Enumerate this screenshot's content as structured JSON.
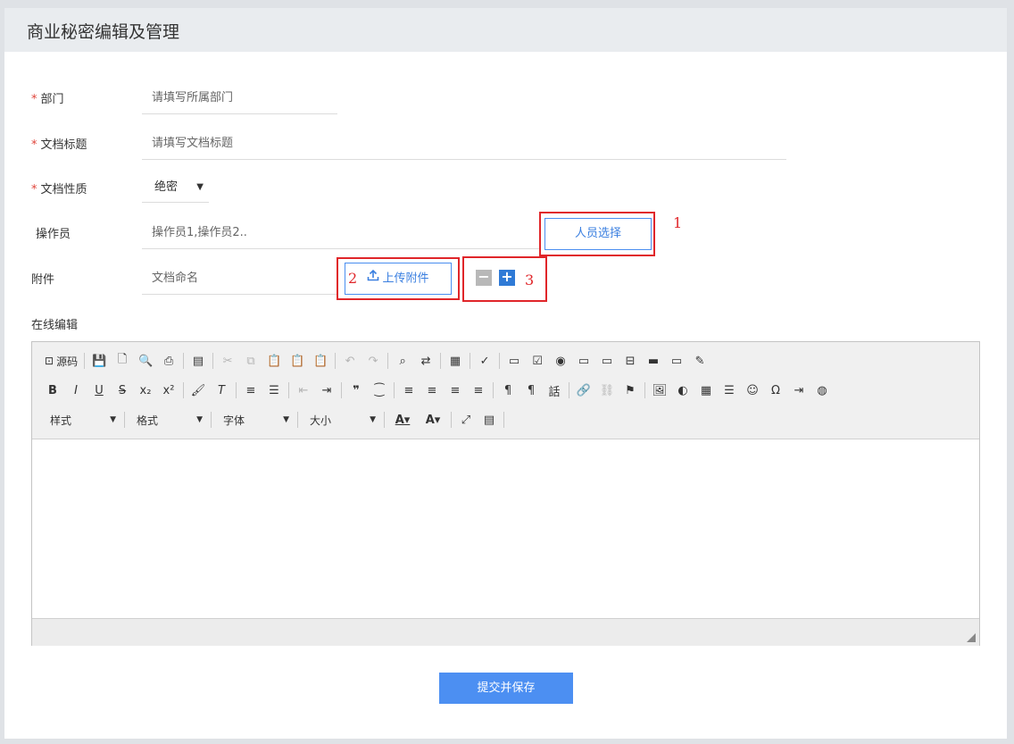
{
  "header": {
    "title": "商业秘密编辑及管理"
  },
  "form": {
    "department": {
      "label": "部门",
      "required": "*",
      "placeholder": "请填写所属部门"
    },
    "doc_title": {
      "label": "文档标题",
      "required": "*",
      "placeholder": "请填写文档标题"
    },
    "doc_nature": {
      "label": "文档性质",
      "required": "*",
      "value": "绝密"
    },
    "operator": {
      "label": "操作员",
      "value": "操作员1,操作员2..",
      "button": "人员选择"
    },
    "attachment": {
      "label": "附件",
      "placeholder": "文档命名",
      "upload_button": "上传附件"
    },
    "online_edit_label": "在线编辑",
    "submit_label": "提交并保存"
  },
  "annotations": {
    "one": "1",
    "two": "2",
    "three": "3"
  },
  "editor": {
    "source_label": "源码",
    "combos": {
      "style": "样式",
      "format": "格式",
      "font": "字体",
      "size": "大小"
    }
  },
  "colors": {
    "accent": "#4c8ff2",
    "annotation": "#e0262a",
    "required": "#e0443a"
  }
}
